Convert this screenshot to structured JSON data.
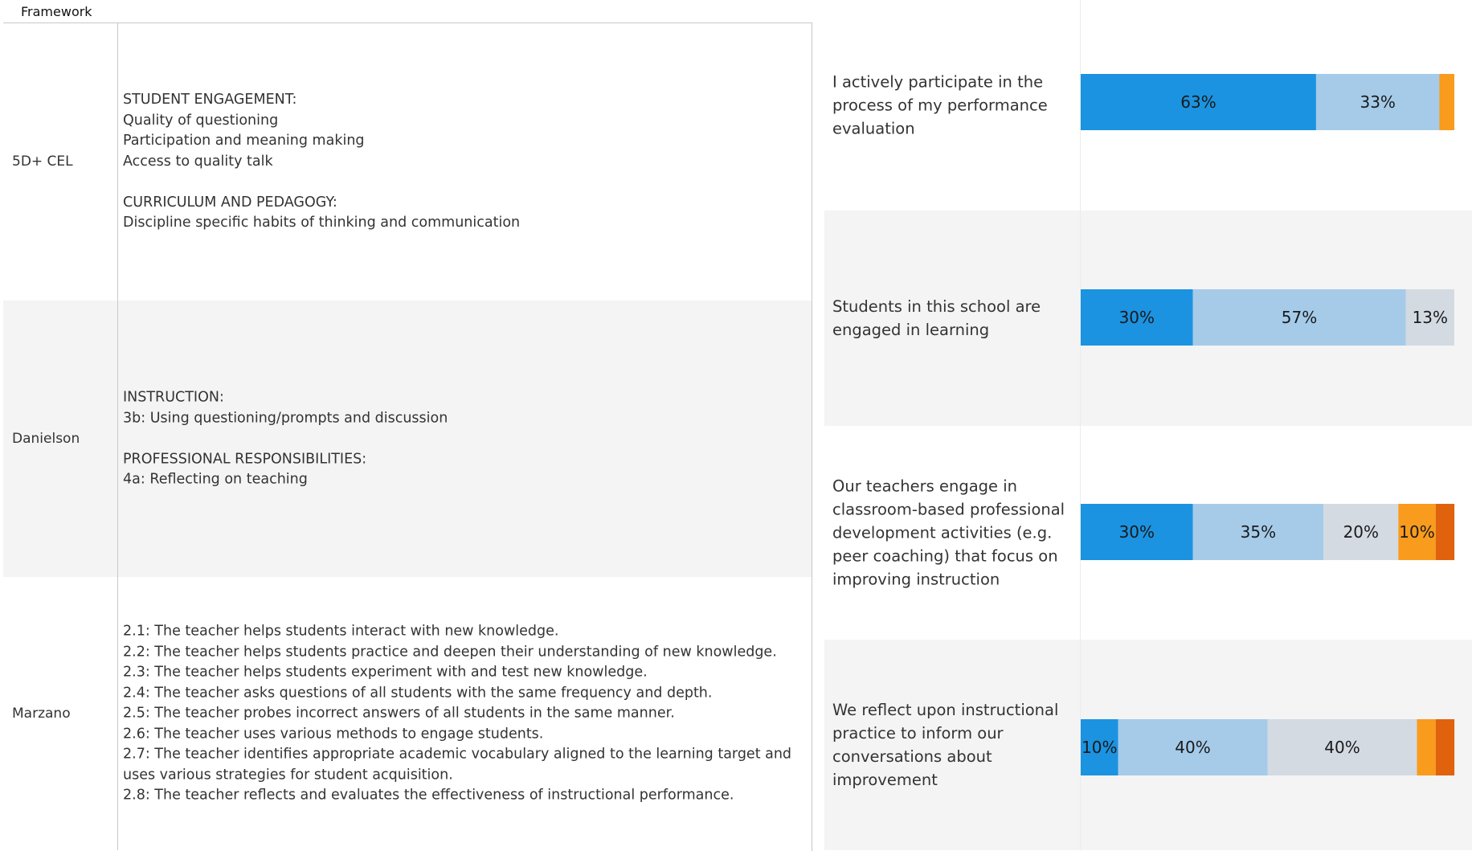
{
  "table": {
    "header": "Framework",
    "rows": [
      {
        "name": "5D+ CEL",
        "lines": [
          "STUDENT ENGAGEMENT:",
          "Quality of questioning",
          "Participation and meaning making",
          "Access to quality talk",
          "",
          "CURRICULUM AND PEDAGOGY:",
          "Discipline specific habits of thinking and communication"
        ]
      },
      {
        "name": "Danielson",
        "lines": [
          "INSTRUCTION:",
          "3b: Using questioning/prompts and discussion",
          "",
          "PROFESSIONAL RESPONSIBILITIES:",
          "4a: Reflecting on teaching"
        ]
      },
      {
        "name": "Marzano",
        "lines": [
          "2.1: The teacher helps students interact with new knowledge.",
          "2.2: The teacher helps students practice and deepen their understanding of new knowledge.",
          "2.3: The teacher helps students experiment with and test new knowledge.",
          "2.4: The teacher asks questions of all students with the same frequency and depth.",
          "2.5: The teacher probes incorrect answers of all students in the same manner.",
          "2.6: The teacher uses various methods to engage students.",
          "2.7: The teacher identifies appropriate academic vocabulary aligned to the learning target and uses various strategies for student acquisition.",
          "2.8: The teacher reflects and evaluates the effectiveness of instructional performance."
        ]
      }
    ]
  },
  "chart_data": {
    "type": "bar",
    "orientation": "horizontal",
    "stacked": true,
    "value_format": "percent",
    "xlim": [
      0,
      100
    ],
    "categories": [
      "I actively participate in the process of my performance evaluation",
      "Students in this school are engaged in learning",
      "Our teachers engage in classroom-based professional development activities (e.g. peer coaching) that focus on improving instruction",
      "We reflect upon instructional practice to inform our conversations about improvement"
    ],
    "series": [
      {
        "color": "#1b93e0",
        "values": [
          63,
          30,
          30,
          10
        ]
      },
      {
        "color": "#a5cbe9",
        "values": [
          33,
          57,
          35,
          40
        ]
      },
      {
        "color": "#d3dae2",
        "values": [
          0,
          13,
          20,
          40
        ]
      },
      {
        "color": "#f99b1d",
        "values": [
          4,
          0,
          10,
          5
        ]
      },
      {
        "color": "#e0620d",
        "values": [
          0,
          0,
          5,
          5
        ]
      }
    ],
    "data_labels": [
      [
        "63%",
        "33%",
        "",
        "",
        ""
      ],
      [
        "30%",
        "57%",
        "13%",
        "",
        ""
      ],
      [
        "30%",
        "35%",
        "20%",
        "10%",
        ""
      ],
      [
        "10%",
        "40%",
        "40%",
        "",
        ""
      ]
    ],
    "grid": false,
    "legend": "none"
  }
}
